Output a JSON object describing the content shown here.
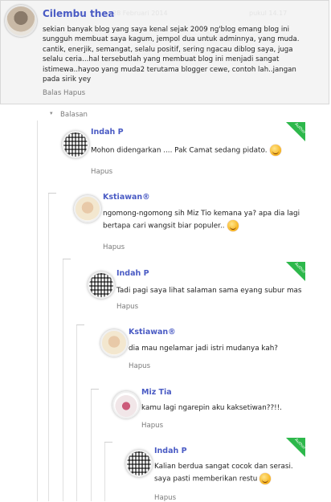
{
  "main_comment": {
    "author": "Cilembu thea",
    "meta_left": "28 Februari 2014",
    "meta_right": "pukul 14.17",
    "text_lines": [
      "sekian banyak blog yang saya kenal sejak 2009 ng'blog emang blog ini",
      "sungguh membuat saya kagum, jempol dua untuk adminnya, yang muda.",
      "cantik, enerjik, semangat, selalu positif, sering ngacau diblog saya, juga",
      "selalu ceria...hal tersebutlah yang membuat blog ini menjadi sangat",
      "istimewa..hayoo yang muda2 terutama blogger cewe, contoh lah..jangan",
      "pada sirik yey"
    ],
    "actions": "Balas Hapus"
  },
  "thread_toggle": {
    "caret": "▾",
    "label": "Balasan"
  },
  "replies": [
    {
      "author": "Indah P",
      "text": "Mohon didengarkan .... Pak Camat sedang pidato.",
      "smiley": true,
      "author_badge": true,
      "badge_label": "Author",
      "delete": "Hapus",
      "avatar": "qr"
    },
    {
      "author": "Kstiawan®",
      "text_lines": [
        "ngomong-ngomong sih Miz Tio kemana ya? apa dia lagi",
        "bertapa cari wangsit biar populer.."
      ],
      "smiley": true,
      "author_badge": false,
      "delete": "Hapus",
      "avatar": "photo-k"
    },
    {
      "author": "Indah P",
      "text": "Tadi pagi saya lihat salaman sama eyang subur mas",
      "smiley": false,
      "author_badge": true,
      "badge_label": "Author",
      "delete": "Hapus",
      "avatar": "qr"
    },
    {
      "author": "Kstiawan®",
      "text": "dia mau ngelamar jadi istri mudanya kah?",
      "smiley": false,
      "author_badge": false,
      "delete": "Hapus",
      "avatar": "photo-k"
    },
    {
      "author": "Miz Tia",
      "text": "kamu lagi ngarepin aku kaksetiwan??!!.",
      "smiley": false,
      "author_badge": false,
      "delete": "Hapus",
      "avatar": "photo-m"
    },
    {
      "author": "Indah P",
      "text_lines": [
        "Kalian berdua sangat cocok dan serasi.",
        "saya pasti memberikan restu"
      ],
      "smiley": true,
      "author_badge": true,
      "badge_label": "Author",
      "delete": "Hapus",
      "avatar": "qr"
    }
  ],
  "colors": {
    "link": "#4a5bc4",
    "author_badge": "#2db84b",
    "box_bg": "#f4f4f4"
  }
}
